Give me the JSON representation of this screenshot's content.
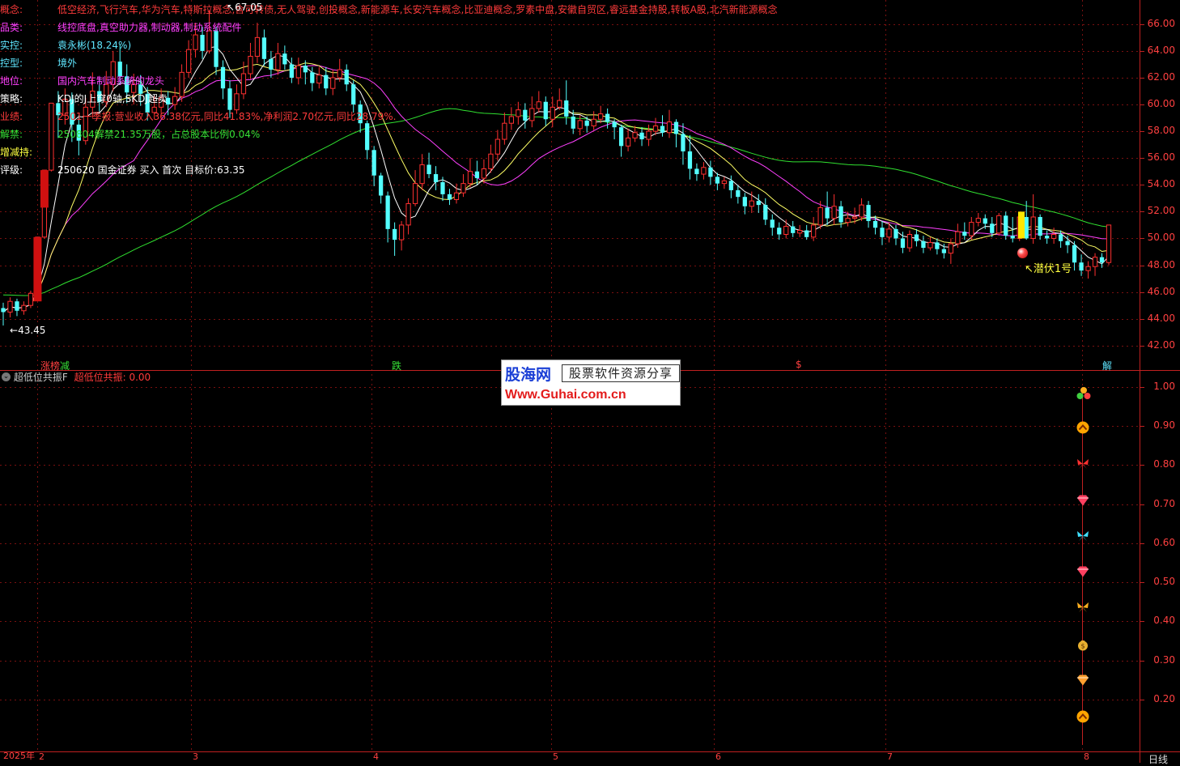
{
  "info_panel": [
    {
      "label": "概念:",
      "value": "低空经济,飞行汽车,华为汽车,特斯拉概念,含可转债,无人驾驶,创投概念,新能源车,长安汽车概念,比亚迪概念,罗素中盘,安徽自贸区,睿远基金持股,转板A股,北汽新能源概念",
      "label_color": "#ff3b3b",
      "value_color": "#ff3b3b"
    },
    {
      "label": "品类:",
      "value": "线控底盘,真空助力器,制动器,制动系统配件",
      "label_color": "#ff40ff",
      "value_color": "#ff40ff"
    },
    {
      "label": "实控:",
      "value": "袁永彬(18.24%)",
      "label_color": "#5fe6ff",
      "value_color": "#5fe6ff"
    },
    {
      "label": "控型:",
      "value": "境外",
      "label_color": "#5fe6ff",
      "value_color": "#5fe6ff"
    },
    {
      "label": "地位:",
      "value": "国内汽车制动系统的龙头",
      "label_color": "#ff40ff",
      "value_color": "#ff40ff"
    },
    {
      "label": "策略:",
      "value": "KDJ的J上穿0轴,SKDJ超卖",
      "label_color": "#ffffff",
      "value_color": "#ffffff"
    },
    {
      "label": "业绩:",
      "value": "2501一季报:营业收入36.38亿元,同比41.83%,净利润2.70亿元,同比28.79%.",
      "label_color": "#ff3b3b",
      "value_color": "#ff3b3b"
    },
    {
      "label": "解禁:",
      "value": "250804解禁21.35万股，占总股本比例0.04%",
      "label_color": "#36e036",
      "value_color": "#36e036"
    },
    {
      "label": "增减持:",
      "value": "",
      "label_color": "#ffff40",
      "value_color": "#ffff40"
    },
    {
      "label": "评级:",
      "value": "250620 国金证券 买入 首次 目标价:63.35",
      "label_color": "#ffffff",
      "value_color": "#ffffff"
    }
  ],
  "price_axis": {
    "ticks": [
      "66.00",
      "64.00",
      "62.00",
      "60.00",
      "58.00",
      "56.00",
      "54.00",
      "52.00",
      "50.00",
      "48.00",
      "46.00",
      "44.00",
      "42.00"
    ],
    "ylim": [
      41.2,
      67.5
    ],
    "color": "#ff4040"
  },
  "indicator_axis": {
    "ticks": [
      "1.00",
      "0.90",
      "0.80",
      "0.70",
      "0.60",
      "0.50",
      "0.40",
      "0.30",
      "0.20"
    ],
    "color": "#ff4040"
  },
  "annotations": {
    "high_label": "67.05",
    "low_label": "43.45",
    "signal_label": "潜伏1号"
  },
  "events": [
    {
      "text": "涨榜",
      "color": "#ff4040"
    },
    {
      "text": "减",
      "color": "#36e036"
    },
    {
      "text": "跌",
      "color": "#36e036"
    },
    {
      "text": "$",
      "color": "#ff4040"
    },
    {
      "text": "解",
      "color": "#5fe6ff"
    }
  ],
  "indicator_header": {
    "name": "超低位共振F",
    "param_label": "超低位共振:",
    "param_value": "0.00",
    "name_color": "#cccccc",
    "param_color": "#ff3b3b"
  },
  "dates": [
    "2025年",
    "2",
    "3",
    "4",
    "5",
    "6",
    "7",
    "8"
  ],
  "period_label": "日线",
  "watermark": {
    "brand": "股海网",
    "slogan": "股票软件资源分享",
    "url": "Www.Guhai.com.cn"
  },
  "colors": {
    "up": "#ff3030",
    "down": "#54ffff",
    "ma5": "#ffffff",
    "ma10": "#ffff66",
    "ma20": "#ff40ff",
    "ma60": "#30e030",
    "grid": "#7a1010"
  },
  "chart_data": {
    "type": "candlestick",
    "ylim": [
      41.2,
      67.5
    ],
    "series": [
      {
        "name": "candles",
        "values": [
          [
            44.8,
            44.5,
            45.2,
            43.5
          ],
          [
            44.5,
            45.3,
            45.6,
            44.1
          ],
          [
            45.3,
            44.6,
            45.5,
            44.2
          ],
          [
            44.6,
            45.0,
            45.3,
            44.3
          ],
          [
            45.0,
            45.9,
            46.1,
            44.8
          ],
          [
            45.9,
            50.1,
            50.1,
            45.8
          ],
          [
            50.1,
            55.1,
            55.1,
            50.0
          ],
          [
            55.1,
            60.1,
            60.1,
            55.0
          ],
          [
            60.1,
            59.2,
            61.0,
            57.5
          ],
          [
            59.2,
            60.4,
            61.2,
            58.5
          ],
          [
            60.4,
            58.5,
            60.9,
            57.2
          ],
          [
            58.5,
            57.3,
            59.2,
            56.2
          ],
          [
            57.3,
            59.8,
            60.5,
            57.0
          ],
          [
            59.8,
            61.0,
            62.4,
            59.0
          ],
          [
            61.0,
            60.2,
            62.0,
            59.4
          ],
          [
            60.2,
            61.5,
            62.5,
            59.8
          ],
          [
            61.5,
            63.2,
            64.0,
            61.0
          ],
          [
            63.2,
            62.1,
            64.5,
            61.5
          ],
          [
            62.1,
            60.9,
            63.0,
            60.1
          ],
          [
            60.9,
            61.5,
            62.3,
            60.0
          ],
          [
            61.5,
            60.8,
            62.2,
            59.9
          ],
          [
            60.8,
            59.4,
            61.3,
            58.8
          ],
          [
            59.4,
            59.8,
            60.7,
            58.9
          ],
          [
            59.8,
            60.5,
            61.2,
            59.3
          ],
          [
            60.5,
            60.0,
            61.0,
            59.2
          ],
          [
            60.0,
            60.6,
            61.3,
            59.6
          ],
          [
            60.6,
            62.4,
            63.0,
            60.2
          ],
          [
            62.4,
            64.1,
            64.8,
            62.0
          ],
          [
            64.1,
            65.2,
            66.1,
            63.5
          ],
          [
            65.2,
            64.0,
            65.8,
            63.4
          ],
          [
            64.0,
            65.5,
            67.05,
            63.8
          ],
          [
            65.5,
            62.8,
            65.8,
            62.2
          ],
          [
            62.8,
            61.2,
            63.3,
            60.4
          ],
          [
            61.2,
            59.6,
            61.8,
            59.0
          ],
          [
            59.6,
            60.8,
            61.5,
            59.3
          ],
          [
            60.8,
            62.3,
            63.2,
            60.4
          ],
          [
            62.3,
            63.6,
            64.6,
            61.9
          ],
          [
            63.6,
            65.0,
            66.1,
            63.1
          ],
          [
            65.0,
            63.4,
            65.6,
            62.9
          ],
          [
            63.4,
            62.6,
            64.0,
            62.0
          ],
          [
            62.6,
            63.8,
            64.6,
            62.2
          ],
          [
            63.8,
            63.0,
            64.4,
            62.6
          ],
          [
            63.0,
            62.0,
            63.5,
            61.6
          ],
          [
            62.0,
            62.9,
            63.5,
            61.5
          ],
          [
            62.9,
            62.4,
            63.3,
            61.5
          ],
          [
            62.4,
            61.6,
            62.8,
            61.0
          ],
          [
            61.6,
            62.2,
            62.8,
            61.2
          ],
          [
            62.2,
            61.2,
            62.8,
            60.7
          ],
          [
            61.2,
            62.0,
            62.6,
            60.7
          ],
          [
            62.0,
            62.6,
            63.4,
            61.7
          ],
          [
            62.6,
            61.5,
            63.0,
            61.0
          ],
          [
            61.5,
            60.0,
            61.8,
            59.4
          ],
          [
            60.0,
            58.6,
            60.3,
            57.9
          ],
          [
            58.6,
            56.6,
            58.8,
            55.9
          ],
          [
            56.6,
            54.7,
            56.9,
            53.9
          ],
          [
            54.7,
            53.2,
            54.9,
            52.6
          ],
          [
            53.2,
            50.7,
            53.5,
            49.7
          ],
          [
            50.7,
            49.9,
            51.2,
            48.7
          ],
          [
            49.9,
            51.0,
            51.3,
            49.1
          ],
          [
            51.0,
            52.6,
            53.0,
            50.3
          ],
          [
            52.6,
            54.1,
            55.1,
            52.4
          ],
          [
            54.1,
            55.5,
            56.3,
            53.6
          ],
          [
            55.5,
            54.8,
            56.4,
            54.5
          ],
          [
            54.8,
            54.2,
            55.4,
            53.6
          ],
          [
            54.2,
            53.3,
            54.6,
            52.8
          ],
          [
            53.3,
            52.9,
            53.7,
            52.5
          ],
          [
            52.9,
            53.4,
            54.1,
            52.6
          ],
          [
            53.4,
            54.1,
            54.8,
            53.1
          ],
          [
            54.1,
            55.0,
            56.0,
            53.8
          ],
          [
            55.0,
            54.5,
            55.8,
            54.0
          ],
          [
            54.5,
            55.2,
            55.9,
            54.1
          ],
          [
            55.2,
            56.3,
            57.0,
            54.9
          ],
          [
            56.3,
            57.4,
            58.1,
            55.8
          ],
          [
            57.4,
            58.6,
            59.4,
            57.0
          ],
          [
            58.6,
            59.1,
            59.8,
            58.1
          ],
          [
            59.1,
            59.6,
            60.2,
            58.5
          ],
          [
            59.6,
            58.8,
            60.1,
            58.2
          ],
          [
            58.8,
            59.7,
            60.6,
            58.3
          ],
          [
            59.7,
            60.2,
            61.0,
            59.4
          ],
          [
            60.2,
            58.9,
            60.6,
            58.4
          ],
          [
            58.9,
            59.8,
            60.6,
            58.3
          ],
          [
            59.8,
            60.3,
            61.2,
            59.6
          ],
          [
            60.3,
            59.1,
            61.8,
            58.5
          ],
          [
            59.1,
            58.2,
            59.6,
            57.8
          ],
          [
            58.2,
            58.8,
            59.2,
            57.7
          ],
          [
            58.8,
            58.4,
            59.1,
            57.9
          ],
          [
            58.4,
            58.9,
            59.5,
            58.1
          ],
          [
            58.9,
            59.3,
            59.9,
            58.6
          ],
          [
            59.3,
            58.7,
            59.7,
            58.2
          ],
          [
            58.7,
            58.3,
            58.9,
            57.4
          ],
          [
            58.3,
            56.9,
            58.5,
            56.1
          ],
          [
            56.9,
            57.5,
            58.2,
            56.5
          ],
          [
            57.5,
            57.9,
            58.4,
            57.2
          ],
          [
            57.9,
            57.4,
            58.3,
            56.9
          ],
          [
            57.4,
            58.0,
            58.5,
            56.9
          ],
          [
            58.0,
            58.4,
            59.0,
            57.7
          ],
          [
            58.4,
            57.9,
            59.2,
            57.6
          ],
          [
            57.9,
            58.7,
            59.6,
            57.5
          ],
          [
            58.7,
            57.8,
            58.9,
            56.8
          ],
          [
            57.8,
            56.5,
            58.6,
            55.5
          ],
          [
            56.5,
            55.2,
            57.7,
            54.4
          ],
          [
            55.2,
            54.8,
            55.6,
            54.3
          ],
          [
            54.8,
            55.3,
            55.7,
            54.4
          ],
          [
            55.3,
            54.6,
            55.8,
            54.0
          ],
          [
            54.6,
            54.1,
            54.9,
            53.6
          ],
          [
            54.1,
            54.3,
            54.6,
            53.7
          ],
          [
            54.3,
            53.6,
            54.7,
            53.0
          ],
          [
            53.6,
            53.1,
            54.0,
            52.6
          ],
          [
            53.1,
            52.4,
            53.4,
            51.8
          ],
          [
            52.4,
            52.8,
            53.5,
            51.9
          ],
          [
            52.8,
            52.5,
            53.3,
            51.9
          ],
          [
            52.5,
            51.4,
            53.0,
            51.0
          ],
          [
            51.4,
            50.8,
            51.8,
            50.2
          ],
          [
            50.8,
            50.3,
            51.2,
            49.9
          ],
          [
            50.3,
            50.9,
            51.4,
            50.0
          ],
          [
            50.9,
            50.4,
            51.3,
            50.1
          ],
          [
            50.4,
            50.6,
            51.0,
            50.1
          ],
          [
            50.6,
            50.1,
            51.0,
            49.9
          ],
          [
            50.1,
            51.0,
            51.6,
            49.8
          ],
          [
            51.0,
            52.3,
            52.8,
            50.7
          ],
          [
            52.3,
            51.5,
            53.5,
            51.0
          ],
          [
            51.5,
            52.4,
            53.3,
            51.0
          ],
          [
            52.4,
            51.2,
            52.8,
            50.8
          ],
          [
            51.2,
            51.5,
            52.0,
            50.9
          ],
          [
            51.5,
            51.6,
            52.3,
            51.1
          ],
          [
            51.6,
            52.5,
            53.0,
            51.3
          ],
          [
            52.5,
            51.3,
            52.8,
            50.8
          ],
          [
            51.3,
            50.8,
            51.7,
            50.3
          ],
          [
            50.8,
            50.1,
            51.3,
            49.5
          ],
          [
            50.1,
            50.7,
            51.2,
            49.7
          ],
          [
            50.7,
            50.0,
            51.0,
            49.5
          ],
          [
            50.0,
            49.3,
            50.5,
            48.9
          ],
          [
            49.3,
            50.3,
            50.6,
            49.0
          ],
          [
            50.3,
            49.8,
            50.7,
            49.4
          ],
          [
            49.8,
            49.3,
            50.2,
            48.9
          ],
          [
            49.3,
            49.7,
            50.1,
            49.1
          ],
          [
            49.7,
            49.2,
            50.0,
            48.8
          ],
          [
            49.2,
            48.9,
            49.6,
            48.5
          ],
          [
            48.9,
            49.6,
            50.0,
            48.1
          ],
          [
            49.6,
            50.5,
            51.1,
            49.3
          ],
          [
            50.5,
            50.2,
            51.2,
            49.9
          ],
          [
            50.2,
            51.2,
            51.6,
            49.9
          ],
          [
            51.2,
            51.5,
            51.9,
            50.9
          ],
          [
            51.5,
            51.1,
            51.8,
            50.7
          ],
          [
            51.1,
            50.4,
            51.6,
            50.1
          ],
          [
            50.4,
            51.7,
            51.9,
            50.2
          ],
          [
            51.7,
            50.2,
            52.0,
            49.9
          ],
          [
            50.2,
            50.0,
            51.6,
            49.7
          ],
          [
            50.0,
            51.6,
            51.9,
            49.8
          ],
          [
            51.6,
            50.0,
            52.8,
            49.9
          ],
          [
            50.0,
            51.6,
            53.3,
            49.6
          ],
          [
            51.6,
            50.2,
            51.8,
            49.9
          ],
          [
            50.2,
            50.0,
            50.6,
            49.6
          ],
          [
            50.0,
            50.3,
            50.8,
            49.6
          ],
          [
            50.3,
            49.8,
            50.6,
            49.3
          ],
          [
            49.8,
            49.5,
            50.2,
            48.9
          ],
          [
            49.5,
            48.2,
            49.8,
            47.6
          ],
          [
            48.2,
            47.6,
            48.8,
            47.2
          ],
          [
            47.6,
            47.9,
            48.3,
            47.0
          ],
          [
            47.9,
            48.6,
            48.9,
            47.2
          ],
          [
            48.6,
            48.2,
            48.9,
            47.8
          ],
          [
            48.2,
            51.0,
            51.0,
            48.0
          ]
        ]
      }
    ]
  },
  "icons": [
    "cluster-icon",
    "up-arrow-icon",
    "butterfly-icon",
    "diamond-icon",
    "butterfly-icon",
    "diamond-icon",
    "butterfly-icon",
    "money-bag-icon",
    "diamond-icon",
    "up-arrow-icon"
  ]
}
